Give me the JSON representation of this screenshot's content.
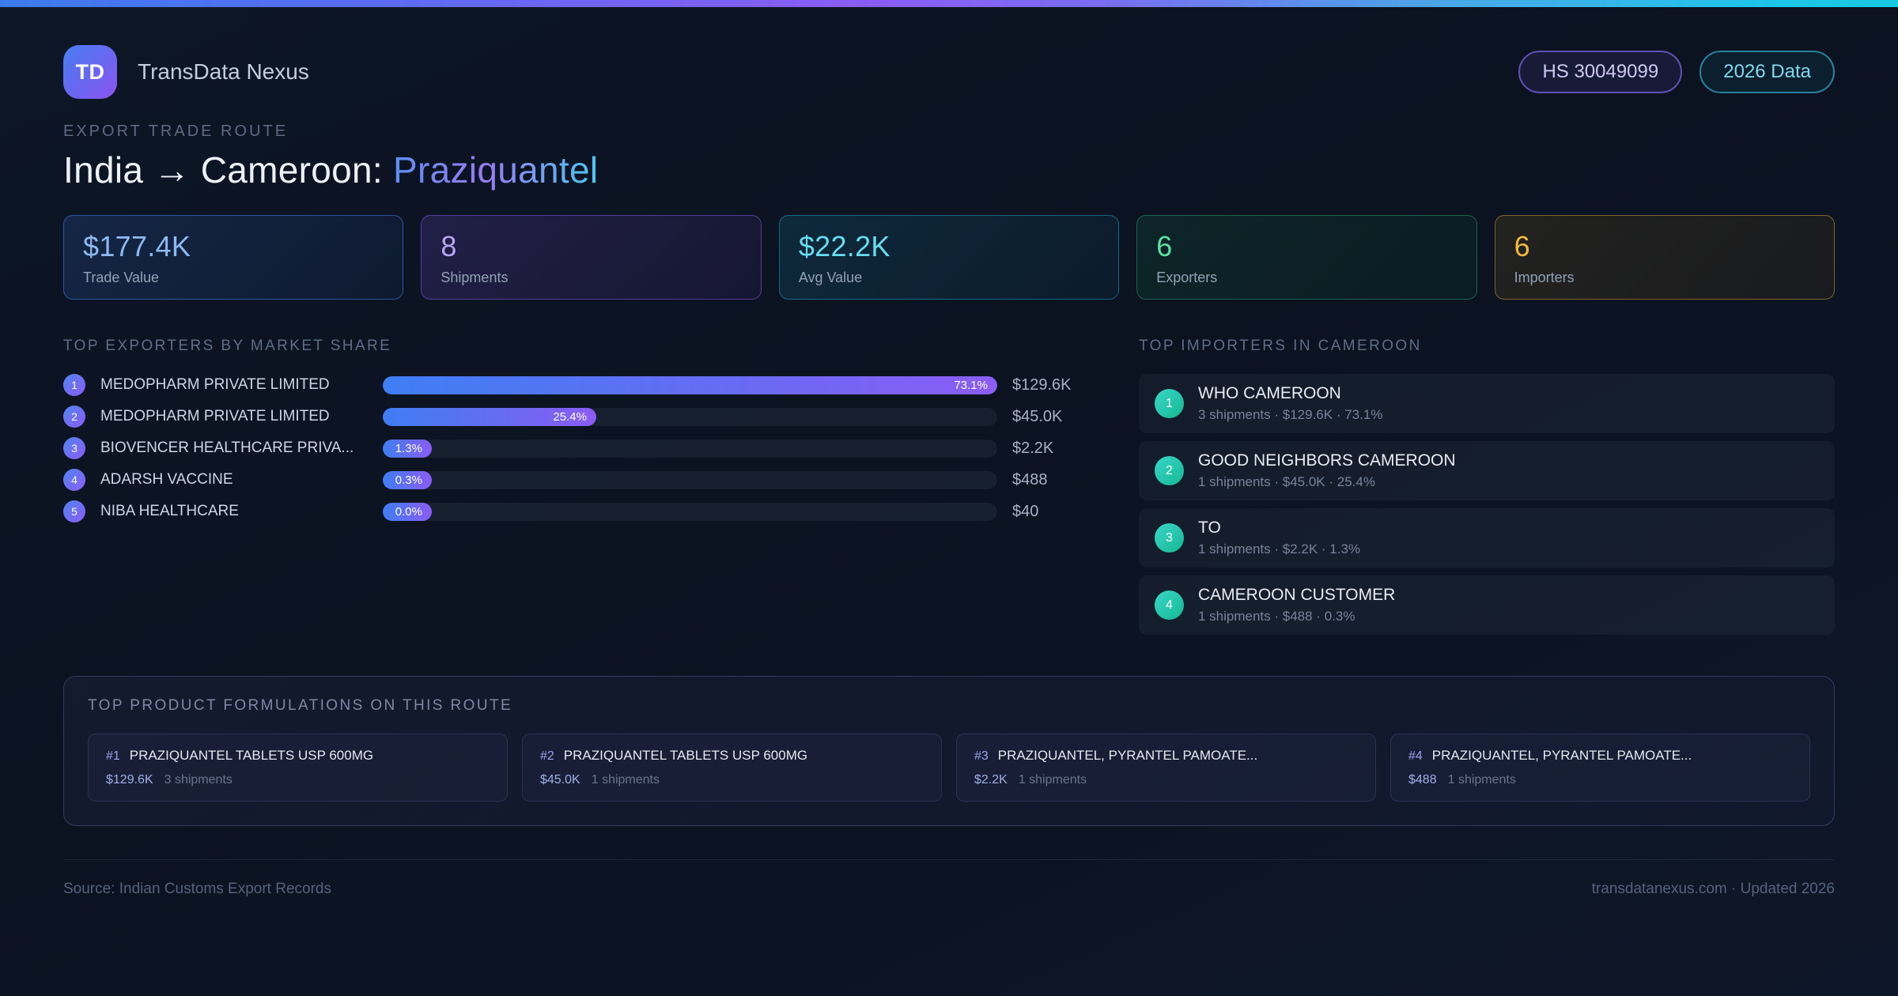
{
  "header": {
    "logo_text": "TD",
    "app_name": "TransData Nexus",
    "hs_badge": "HS 30049099",
    "year_badge": "2026 Data"
  },
  "hero": {
    "eyebrow": "EXPORT TRADE ROUTE",
    "title_main": "India → Cameroon: ",
    "title_highlight": "Praziquantel"
  },
  "stats": [
    {
      "value": "$177.4K",
      "label": "Trade Value",
      "theme": "blue",
      "accent": "#8fb8f2"
    },
    {
      "value": "8",
      "label": "Shipments",
      "theme": "purple",
      "accent": "#b9a6f5"
    },
    {
      "value": "$22.2K",
      "label": "Avg Value",
      "theme": "cyan",
      "accent": "#67dcf0"
    },
    {
      "value": "6",
      "label": "Exporters",
      "theme": "green",
      "accent": "#5ce0a1"
    },
    {
      "value": "6",
      "label": "Importers",
      "theme": "amber",
      "accent": "#f5b83d"
    }
  ],
  "exporters": {
    "section_title": "TOP EXPORTERS BY MARKET SHARE",
    "max_share_pct": 73.1,
    "items": [
      {
        "rank": "1",
        "name": "MEDOPHARM PRIVATE LIMITED",
        "share_pct": 73.1,
        "share_label": "73.1%",
        "value": "$129.6K"
      },
      {
        "rank": "2",
        "name": "MEDOPHARM PRIVATE LIMITED",
        "share_pct": 25.4,
        "share_label": "25.4%",
        "value": "$45.0K"
      },
      {
        "rank": "3",
        "name": "BIOVENCER HEALTHCARE PRIVA...",
        "share_pct": 1.3,
        "share_label": "1.3%",
        "value": "$2.2K"
      },
      {
        "rank": "4",
        "name": "ADARSH VACCINE",
        "share_pct": 0.3,
        "share_label": "0.3%",
        "value": "$488"
      },
      {
        "rank": "5",
        "name": "NIBA HEALTHCARE",
        "share_pct": 0.0,
        "share_label": "0.0%",
        "value": "$40"
      }
    ]
  },
  "importers": {
    "section_title": "TOP IMPORTERS IN CAMEROON",
    "items": [
      {
        "rank": "1",
        "name": "WHO CAMEROON",
        "meta": "3 shipments · $129.6K · 73.1%"
      },
      {
        "rank": "2",
        "name": "GOOD NEIGHBORS CAMEROON",
        "meta": "1 shipments · $45.0K · 25.4%"
      },
      {
        "rank": "3",
        "name": "TO",
        "meta": "1 shipments · $2.2K · 1.3%"
      },
      {
        "rank": "4",
        "name": "CAMEROON CUSTOMER",
        "meta": "1 shipments · $488 · 0.3%"
      }
    ]
  },
  "products": {
    "section_title": "TOP PRODUCT FORMULATIONS ON THIS ROUTE",
    "items": [
      {
        "rank": "#1",
        "name": "PRAZIQUANTEL TABLETS USP 600MG",
        "value": "$129.6K",
        "shipments": "3 shipments"
      },
      {
        "rank": "#2",
        "name": "PRAZIQUANTEL TABLETS USP 600MG",
        "value": "$45.0K",
        "shipments": "1 shipments"
      },
      {
        "rank": "#3",
        "name": "PRAZIQUANTEL, PYRANTEL PAMOATE...",
        "value": "$2.2K",
        "shipments": "1 shipments"
      },
      {
        "rank": "#4",
        "name": "PRAZIQUANTEL, PYRANTEL PAMOATE...",
        "value": "$488",
        "shipments": "1 shipments"
      }
    ]
  },
  "footer": {
    "source": "Source: Indian Customs Export Records",
    "site": "transdatanexus.com · Updated 2026"
  },
  "colors": {
    "background": "#0b1220",
    "strip_blue": "#3b7bf0",
    "strip_purple": "#8b5cf6",
    "strip_cyan": "#16c9e0",
    "bar_gradient_start": "#3f7ef5",
    "bar_gradient_end": "#8b5cf6",
    "importer_badge": "#14b893",
    "hs_badge_accent": "#cfc8f4",
    "year_badge_accent": "#7fd9ec"
  }
}
